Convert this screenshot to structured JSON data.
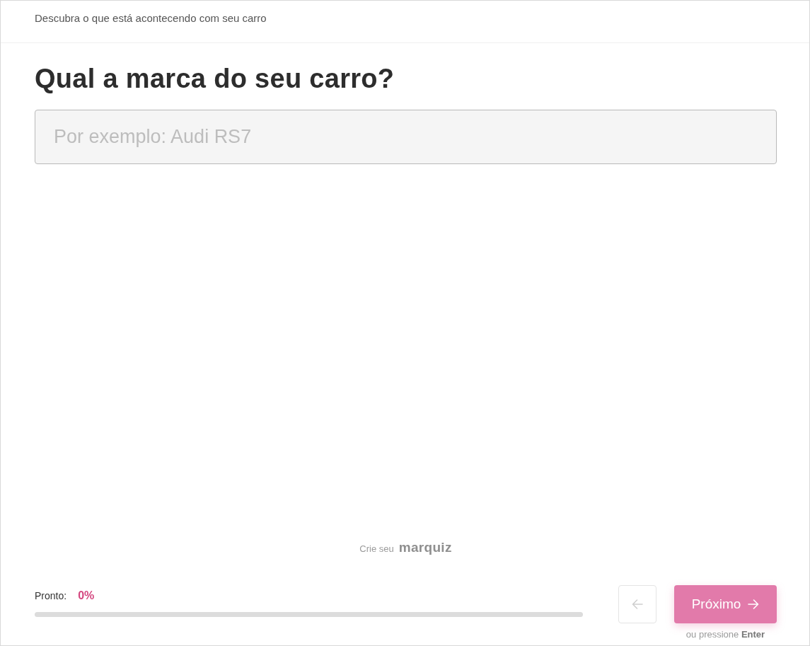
{
  "header": {
    "subtitle": "Descubra o que está acontecendo com seu carro"
  },
  "question": {
    "title": "Qual a marca do seu carro?",
    "input": {
      "placeholder": "Por exemplo: Audi RS7"
    }
  },
  "credit": {
    "text": "Crie seu",
    "brand": "marquiz"
  },
  "footer": {
    "progress": {
      "label": "Pronto:",
      "reading": "0%",
      "level": 0
    },
    "back_button": {
      "disabled": true
    },
    "next_button": {
      "label": "Próximo"
    },
    "hint": "ou pressione **Enter**"
  }
}
